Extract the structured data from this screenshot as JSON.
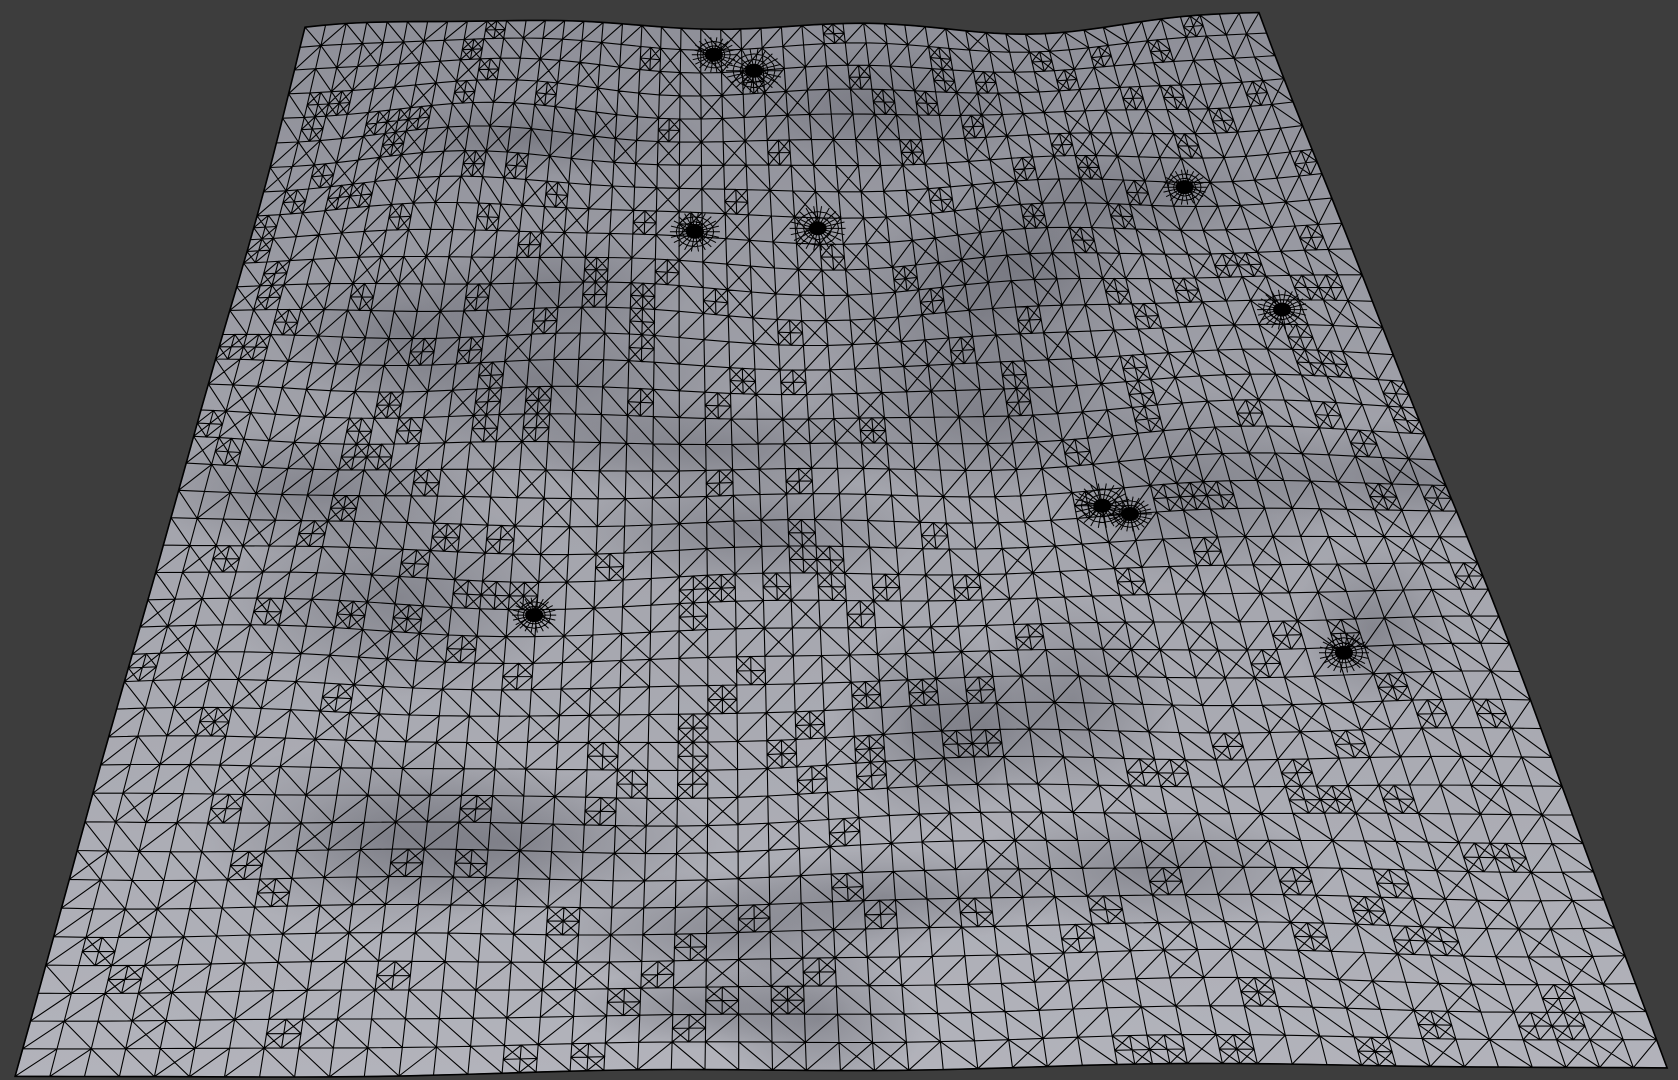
{
  "viewport": {
    "background_color": "#3d3d3d",
    "object": {
      "type": "terrain-mesh",
      "display": "wireframe-on-shaded",
      "surface_color": "#9a9ba3",
      "wire_color": "#000000",
      "dense_vertex_clusters": 10
    }
  }
}
